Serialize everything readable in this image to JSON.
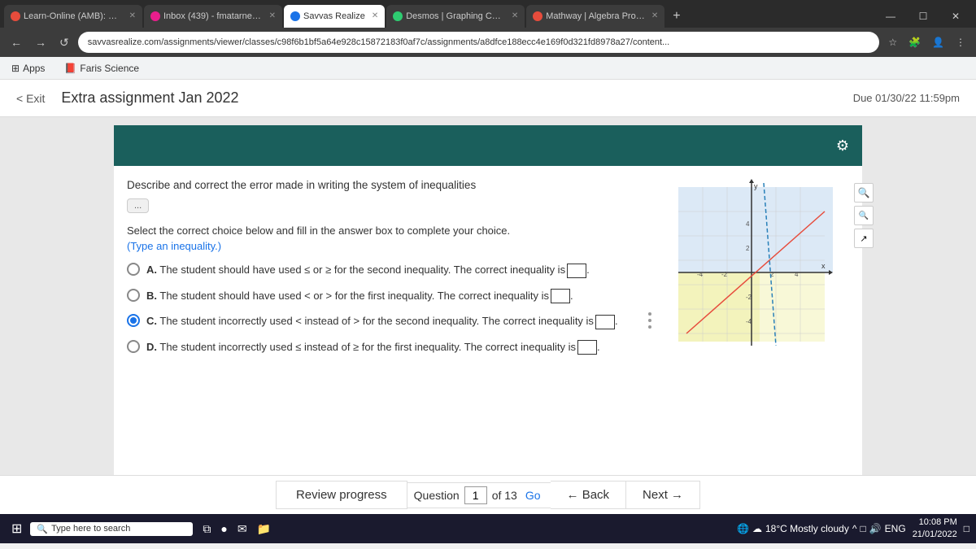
{
  "tabs": [
    {
      "id": "t1",
      "label": "Learn-Online (AMB): Das...",
      "color": "#e74c3c",
      "active": false
    },
    {
      "id": "t2",
      "label": "Inbox (439) - fmatarneh2...",
      "color": "#e91e8c",
      "active": false
    },
    {
      "id": "t3",
      "label": "Savvas Realize",
      "color": "#1a73e8",
      "active": true
    },
    {
      "id": "t4",
      "label": "Desmos | Graphing Calcu...",
      "color": "#2ecc71",
      "active": false
    },
    {
      "id": "t5",
      "label": "Mathway | Algebra Probl...",
      "color": "#e74c3c",
      "active": false
    }
  ],
  "address": "savvasrealize.com/assignments/viewer/classes/c98f6b1bf5a64e928c15872183f0af7c/assignments/a8dfce188ecc4e169f0d321fd8978a27/content...",
  "bookmarks": [
    {
      "label": "Apps"
    },
    {
      "label": "Faris Science"
    }
  ],
  "header": {
    "exit_label": "< Exit",
    "title": "Extra assignment Jan 2022",
    "due_date": "Due 01/30/22 11:59pm"
  },
  "question": {
    "prompt": "Describe and correct the error made in writing the system of inequalities",
    "dots_label": "...",
    "instruction": "Select the correct choice below and fill in the answer box to complete your choice.",
    "instruction_type": "(Type an inequality.)",
    "choices": [
      {
        "letter": "A",
        "text": "The student should have used ≤ or ≥ for the second inequality. The correct inequality is",
        "selected": false
      },
      {
        "letter": "B",
        "text": "The student should have used < or > for the first inequality. The correct inequality is",
        "selected": false
      },
      {
        "letter": "C",
        "text": "The student incorrectly used < instead of > for the second inequality. The correct inequality is",
        "selected": true
      },
      {
        "letter": "D",
        "text": "The student incorrectly used ≤ instead of ≥ for the first inequality. The correct inequality is",
        "selected": false
      }
    ]
  },
  "bottom_nav": {
    "review_label": "Review progress",
    "question_label": "Question",
    "question_number": "1",
    "of_label": "of 13",
    "go_label": "Go",
    "back_label": "← Back",
    "next_label": "Next →"
  },
  "taskbar": {
    "search_placeholder": "Type here to search",
    "weather": "18°C  Mostly cloudy",
    "time": "10:08 PM",
    "date": "21/01/2022",
    "language": "ENG"
  }
}
